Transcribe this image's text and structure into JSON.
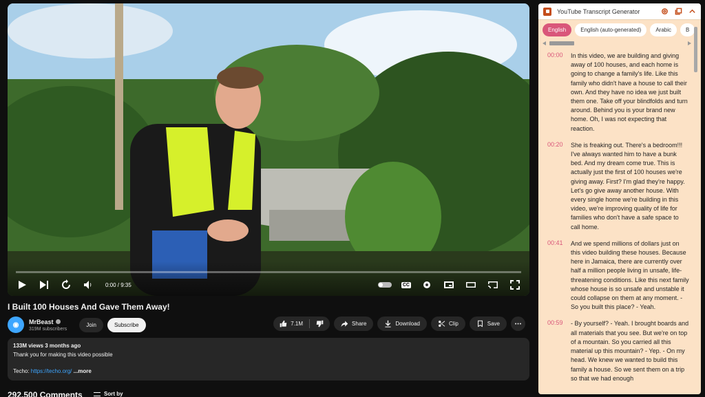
{
  "video": {
    "time": "0:00 / 9:35",
    "cc_label": "CC"
  },
  "title": "I Built 100 Houses And Gave Them Away!",
  "channel": {
    "name": "MrBeast",
    "subscribers": "319M subscribers",
    "join_label": "Join",
    "subscribe_label": "Subscribe"
  },
  "actions": {
    "likes": "7.1M",
    "share": "Share",
    "download": "Download",
    "clip": "Clip",
    "save": "Save"
  },
  "description": {
    "meta": "133M views  3 months ago",
    "line1": "Thank you for making this video possible",
    "techo_label": "Techo: ",
    "techo_link": "https://techo.org/",
    "more": "...more"
  },
  "comments": {
    "count": "292,500 Comments",
    "sort_label": "Sort by"
  },
  "panel": {
    "title": "YouTube Transcript Generator",
    "languages": [
      "English",
      "English (auto-generated)",
      "Arabic",
      "B"
    ],
    "entries": [
      {
        "time": "00:00",
        "text": "In this video, we are building and giving away of 100 houses, and each home is going to change a family's life. Like this family who didn't have a house to call their own. And they have no idea we just built them one. Take off your blindfolds and turn around. Behind you is your brand new home. Oh, I was not expecting that reaction."
      },
      {
        "time": "00:20",
        "text": "She is freaking out. There's a bedroom!!! I've always wanted him to have a bunk bed. And my dream come true. This is actually just the first of 100 houses we're giving away. First? I'm glad they're happy. Let's go give away another house. With every single home we're building in this video, we're improving quality of life for families who don't have a safe space to call home."
      },
      {
        "time": "00:41",
        "text": "And we spend millions of dollars just on this video building these houses. Because here in Jamaica, there are currently over half a million people living in unsafe, life-threatening conditions. Like this next family whose house is so unsafe and unstable it could collapse on them at any moment. - So you built this place? - Yeah."
      },
      {
        "time": "00:59",
        "text": "- By yourself? - Yeah. I brought boards and all materials that you see. But we're on top of a mountain. So you carried all this material up this mountain? - Yep. - On my head. We knew we wanted to build this family a house. So we sent them on a trip so that we had enough"
      }
    ]
  }
}
